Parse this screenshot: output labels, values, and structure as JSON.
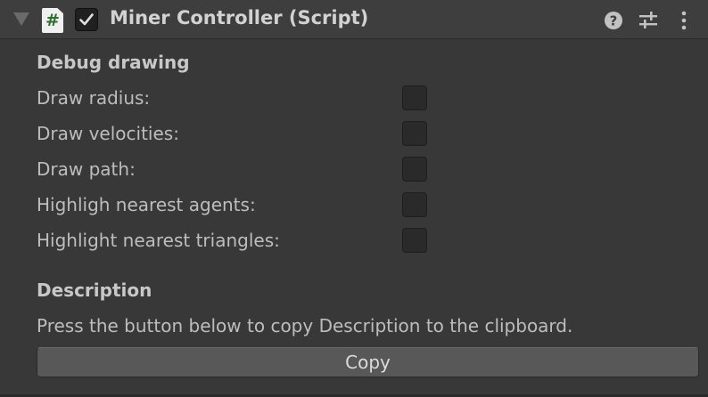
{
  "header": {
    "title": "Miner Controller (Script)",
    "script_icon_glyph": "#",
    "enabled": true,
    "icons": [
      "help-icon",
      "preset-sliders-icon",
      "kebab-menu-icon"
    ]
  },
  "debug": {
    "title": "Debug drawing",
    "fields": [
      {
        "label": "Draw radius:",
        "checked": false
      },
      {
        "label": "Draw velocities:",
        "checked": false
      },
      {
        "label": "Draw path:",
        "checked": false
      },
      {
        "label": "Highligh nearest agents:",
        "checked": false
      },
      {
        "label": "Highlight nearest triangles:",
        "checked": false
      }
    ]
  },
  "description": {
    "title": "Description",
    "text": "Press the button below to copy Description to the clipboard.",
    "button_label": "Copy"
  },
  "colors": {
    "background": "#383838",
    "header": "#3e3e3e",
    "text": "#bdbdbd",
    "button": "#585858"
  }
}
